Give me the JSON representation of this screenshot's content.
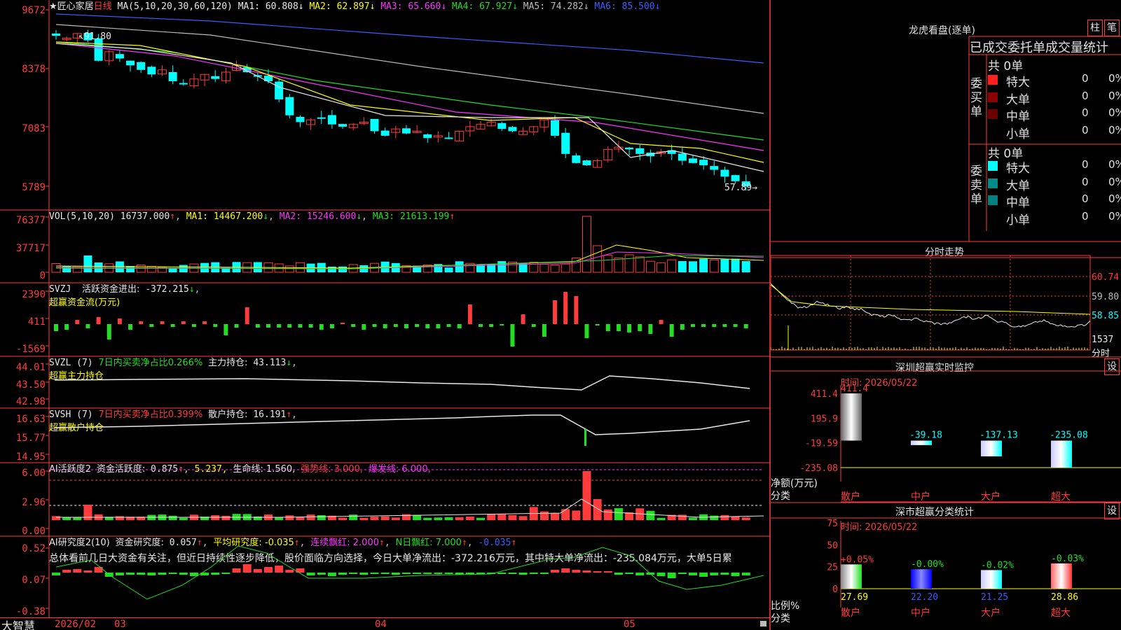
{
  "app": {
    "name": "大智慧"
  },
  "colors": {
    "up": "#ff3b3b",
    "down": "#00ffff",
    "bg": "#000000",
    "ma1": "#e8e8e8",
    "ma2": "#ffff00",
    "ma3": "#ff33ff",
    "ma4": "#22dd22",
    "ma5": "#bbbbbb",
    "ma6": "#3c5cff"
  },
  "price": {
    "stock": "★匠心家居",
    "period": "日线",
    "ma_spec": "MA(5,10,20,30,60,120)",
    "ma": [
      {
        "k": "MA1:",
        "v": "60.808↓"
      },
      {
        "k": "MA2:",
        "v": "62.897↓"
      },
      {
        "k": "MA3:",
        "v": "65.660↓"
      },
      {
        "k": "MA4:",
        "v": "67.927↓"
      },
      {
        "k": "MA5:",
        "v": "74.282↓"
      },
      {
        "k": "MA6:",
        "v": "85.500↓"
      }
    ],
    "axis": [
      "9672",
      "8378",
      "7083",
      "5789"
    ],
    "high_label": "91.80",
    "low_label": "57.89"
  },
  "vol": {
    "name": "VOL(5,10,20)",
    "value": "16737.000",
    "ma1": "MA1: 14467.200",
    "ma2": "MA2: 15246.600",
    "ma3": "MA3: 21613.199",
    "axis": [
      "76377",
      "37717",
      "0"
    ]
  },
  "svzj": {
    "name": "SVZJ",
    "label": "活跃资金进出:",
    "value": "-372.215",
    "sub": "超赢资金流(万元)",
    "axis": [
      "2390",
      "411",
      "-1569"
    ]
  },
  "svzl": {
    "name": "SVZL (7)",
    "ratio": "7日内买卖净占比0.266%",
    "label": "主力持仓:",
    "value": "43.113",
    "sub": "超赢主力持仓",
    "axis": [
      "44.01",
      "43.50",
      "42.98"
    ]
  },
  "svsh": {
    "name": "SVSH (7)",
    "ratio": "7日内买卖净占比0.399%",
    "label": "散户持仓:",
    "value": "16.191",
    "sub": "超赢散户持仓",
    "axis": [
      "16.63",
      "15.77",
      "14.95"
    ]
  },
  "ai1": {
    "name": "AI活跃度2",
    "label": "资金活跃度:",
    "v1": "0.875",
    "v2": "5.237,",
    "life": "生命线: 1.560,",
    "strong": "强势线: 3.000,",
    "burst": "爆发线: 6.000,",
    "axis": [
      "6.00",
      "2.96",
      "0.00"
    ]
  },
  "ai2": {
    "name": "AI研究度2(10)",
    "label": "资金研究度:",
    "v1": "0.057",
    "avg": "平均研究度: -0.035",
    "streak": "连续飘红: 2.000",
    "nday": "N日飘红: 7.000",
    "neg": "-0.035",
    "text": "总体看前几日大资金有关注，但近日持续性逐步降低，股价面临方向选择，今日大单净流出：-372.216万元，其中特大单净流出：-235.084万元，大单5日累",
    "axis": [
      "0.52",
      "0.07",
      "-0.38"
    ]
  },
  "dates": {
    "start": "2026/02",
    "m1": "03",
    "m2": "04",
    "m3": "05"
  },
  "lhb": {
    "title": "龙虎看盘(逐单)",
    "btn1": "柱",
    "btn2": "笔",
    "tabs": [
      "已成交",
      "委托单",
      "成交量统计"
    ],
    "buy": {
      "label": "委买单",
      "total": "共 0单",
      "rows": [
        {
          "name": "特大",
          "n": "0",
          "p": "0%"
        },
        {
          "name": "大单",
          "n": "0",
          "p": "0%"
        },
        {
          "name": "中单",
          "n": "0",
          "p": "0%"
        },
        {
          "name": "小单",
          "n": "0",
          "p": "0%"
        }
      ]
    },
    "sell": {
      "label": "委卖单",
      "total": "共 0单",
      "rows": [
        {
          "name": "特大",
          "n": "0",
          "p": "0%"
        },
        {
          "name": "大单",
          "n": "0",
          "p": "0%"
        },
        {
          "name": "中单",
          "n": "0",
          "p": "0%"
        },
        {
          "name": "小单",
          "n": "0",
          "p": "0%"
        }
      ]
    }
  },
  "intraday": {
    "title": "分时走势",
    "labels": [
      "60.74",
      "59.80",
      "58.85",
      "1537"
    ],
    "unit": "分时"
  },
  "monitor": {
    "title": "深圳超赢实时监控",
    "btn": "设",
    "time": "时间: 2026/05/22",
    "axis": [
      "411.4",
      "195.9",
      "-19.59",
      "-235.08"
    ],
    "bars": [
      {
        "cat": "散户",
        "val": "411.4"
      },
      {
        "cat": "中户",
        "val": "-39.18"
      },
      {
        "cat": "大户",
        "val": "-137.13"
      },
      {
        "cat": "超大",
        "val": "-235.08"
      }
    ],
    "ylabel": "净额(万元)",
    "xlabel": "分类"
  },
  "classify": {
    "title": "深市超赢分类统计",
    "btn": "设",
    "time": "时间: 2026/05/22",
    "axis": [
      "75",
      "50",
      "25",
      "0"
    ],
    "bars": [
      {
        "cat": "散户",
        "val": "27.69",
        "chg": "+0.05%"
      },
      {
        "cat": "中户",
        "val": "22.20",
        "chg": "-0.00%"
      },
      {
        "cat": "大户",
        "val": "21.25",
        "chg": "-0.02%"
      },
      {
        "cat": "超大",
        "val": "28.86",
        "chg": "-0.03%"
      }
    ],
    "ylabel": "比例%",
    "xlabel": "分类"
  }
}
